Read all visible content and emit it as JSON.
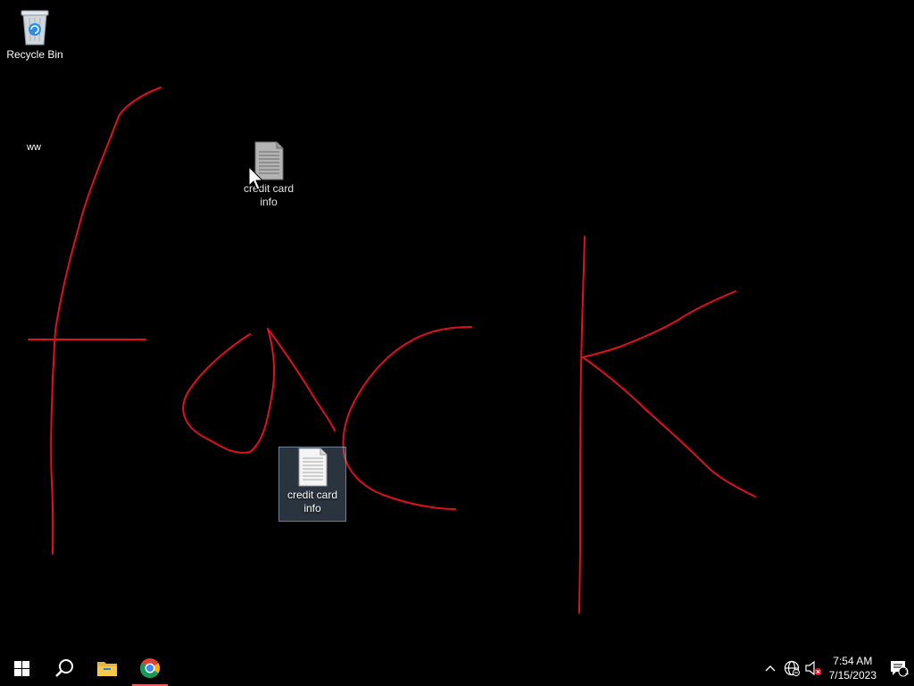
{
  "desktop": {
    "background_color": "#000000",
    "stroke_color": "#e0101e",
    "icons": [
      {
        "label": "Recycle Bin",
        "icon": "recycle-bin-icon"
      },
      {
        "label": "credit card info",
        "icon": "text-document-icon"
      },
      {
        "label": "credit card info",
        "icon": "text-document-icon",
        "selected": true
      }
    ],
    "stray_text": "ww"
  },
  "taskbar": {
    "buttons": [
      {
        "icon": "windows-start-icon"
      },
      {
        "icon": "search-icon"
      },
      {
        "icon": "file-explorer-icon"
      },
      {
        "icon": "chrome-icon",
        "active": true
      }
    ],
    "tray": {
      "icons": [
        "chevron-up-icon",
        "network-icon",
        "volume-muted-icon"
      ],
      "time": "7:54 AM",
      "date": "7/15/2023",
      "notification_count": "1"
    }
  }
}
